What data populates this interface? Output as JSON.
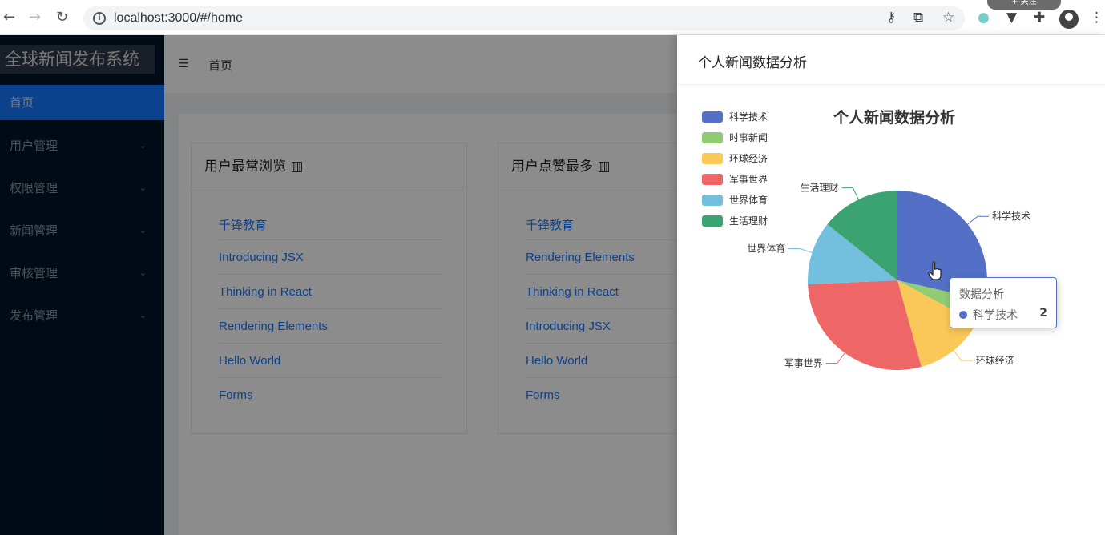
{
  "browser": {
    "url": "localhost:3000/#/home",
    "tab_pill": "+ 关注"
  },
  "app": {
    "logo": "全球新闻发布系统",
    "menu": [
      {
        "label": "首页",
        "active": true
      },
      {
        "label": "用户管理"
      },
      {
        "label": "权限管理"
      },
      {
        "label": "新闻管理"
      },
      {
        "label": "审核管理"
      },
      {
        "label": "发布管理"
      }
    ],
    "breadcrumb": "首页",
    "cards": [
      {
        "title": "用户最常浏览",
        "links": [
          "千锋教育",
          "Introducing JSX",
          "Thinking in React",
          "Rendering Elements",
          "Hello World",
          "Forms"
        ]
      },
      {
        "title": "用户点赞最多",
        "links": [
          "千锋教育",
          "Rendering Elements",
          "Thinking in React",
          "Introducing JSX",
          "Hello World",
          "Forms"
        ]
      }
    ]
  },
  "drawer": {
    "title": "个人新闻数据分析"
  },
  "colors": {
    "科学技术": "#5470c6",
    "时事新闻": "#91cc75",
    "环球经济": "#fac858",
    "军事世界": "#ee6666",
    "世界体育": "#73c0de",
    "生活理财": "#3ba272"
  },
  "chart_data": {
    "type": "pie",
    "title": "个人新闻数据分析",
    "legend_position": "top-left",
    "series": [
      {
        "name": "数据分析",
        "values": [
          {
            "name": "科学技术",
            "value": 2
          },
          {
            "name": "时事新闻",
            "value": 0.3
          },
          {
            "name": "环球经济",
            "value": 0.9
          },
          {
            "name": "军事世界",
            "value": 2
          },
          {
            "name": "世界体育",
            "value": 0.8
          },
          {
            "name": "生活理财",
            "value": 1
          }
        ]
      }
    ],
    "tooltip": {
      "series": "数据分析",
      "name": "科学技术",
      "value": "2"
    }
  }
}
